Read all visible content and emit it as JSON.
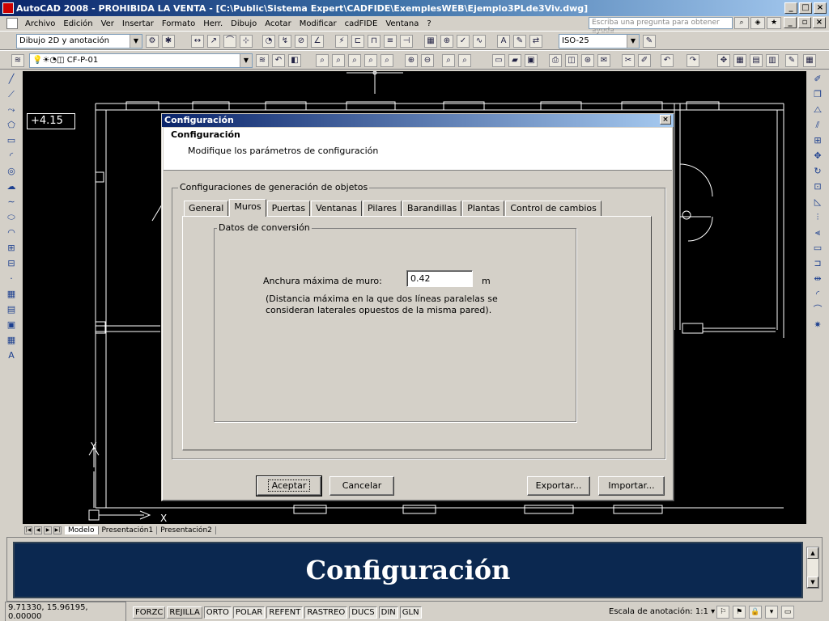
{
  "window": {
    "title": "AutoCAD 2008 - PROHIBIDA LA VENTA - [C:\\Public\\Sistema Expert\\CADFIDE\\ExemplesWEB\\Ejemplo3PLde3Viv.dwg]",
    "min": "_",
    "max": "□",
    "close": "×"
  },
  "menu": [
    "Archivo",
    "Edición",
    "Ver",
    "Insertar",
    "Formato",
    "Herr.",
    "Dibujo",
    "Acotar",
    "Modificar",
    "cadFIDE",
    "Ventana",
    "?"
  ],
  "help_search": {
    "placeholder": "Escriba una pregunta para obtener ayuda"
  },
  "toolbar1": {
    "workspace": "Dibujo 2D y anotación",
    "dimstyle": "ISO-25"
  },
  "toolbar2": {
    "layer": "CF-P-01"
  },
  "drawing": {
    "elevation_label": "+4.15",
    "y_axis": "Y",
    "x_axis": "X"
  },
  "layout_tabs": [
    "Modelo",
    "Presentación1",
    "Presentación2"
  ],
  "dialog": {
    "title": "Configuración",
    "close": "×",
    "header_title": "Configuración",
    "header_subtitle": "Modifique los parámetros de configuración",
    "group_label": "Configuraciones de generación de objetos",
    "tabs": [
      "General",
      "Muros",
      "Puertas",
      "Ventanas",
      "Pilares",
      "Barandillas",
      "Plantas",
      "Control de cambios"
    ],
    "active_tab": "Muros",
    "inner_group_label": "Datos de conversión",
    "field_label": "Anchura máxima de muro:",
    "field_value": "0.42",
    "field_unit": "m",
    "field_help": "(Distancia máxima en la que dos líneas paralelas se consideran laterales opuestos de la misma pared).",
    "buttons": {
      "ok": "Aceptar",
      "cancel": "Cancelar",
      "export": "Exportar...",
      "import": "Importar..."
    }
  },
  "banner": "Configuración",
  "status": {
    "coords": "9.71330, 15.96195, 0.00000",
    "toggles": [
      "FORZC",
      "REJILLA",
      "ORTO",
      "POLAR",
      "REFENT",
      "RASTREO",
      "DUCS",
      "DIN",
      "GLN"
    ],
    "toggles_on": [
      "ORTO",
      "POLAR",
      "REFENT",
      "RASTREO",
      "DUCS",
      "DIN",
      "GLN"
    ],
    "annotation_scale": "Escala de anotación:  1:1 ▾"
  }
}
